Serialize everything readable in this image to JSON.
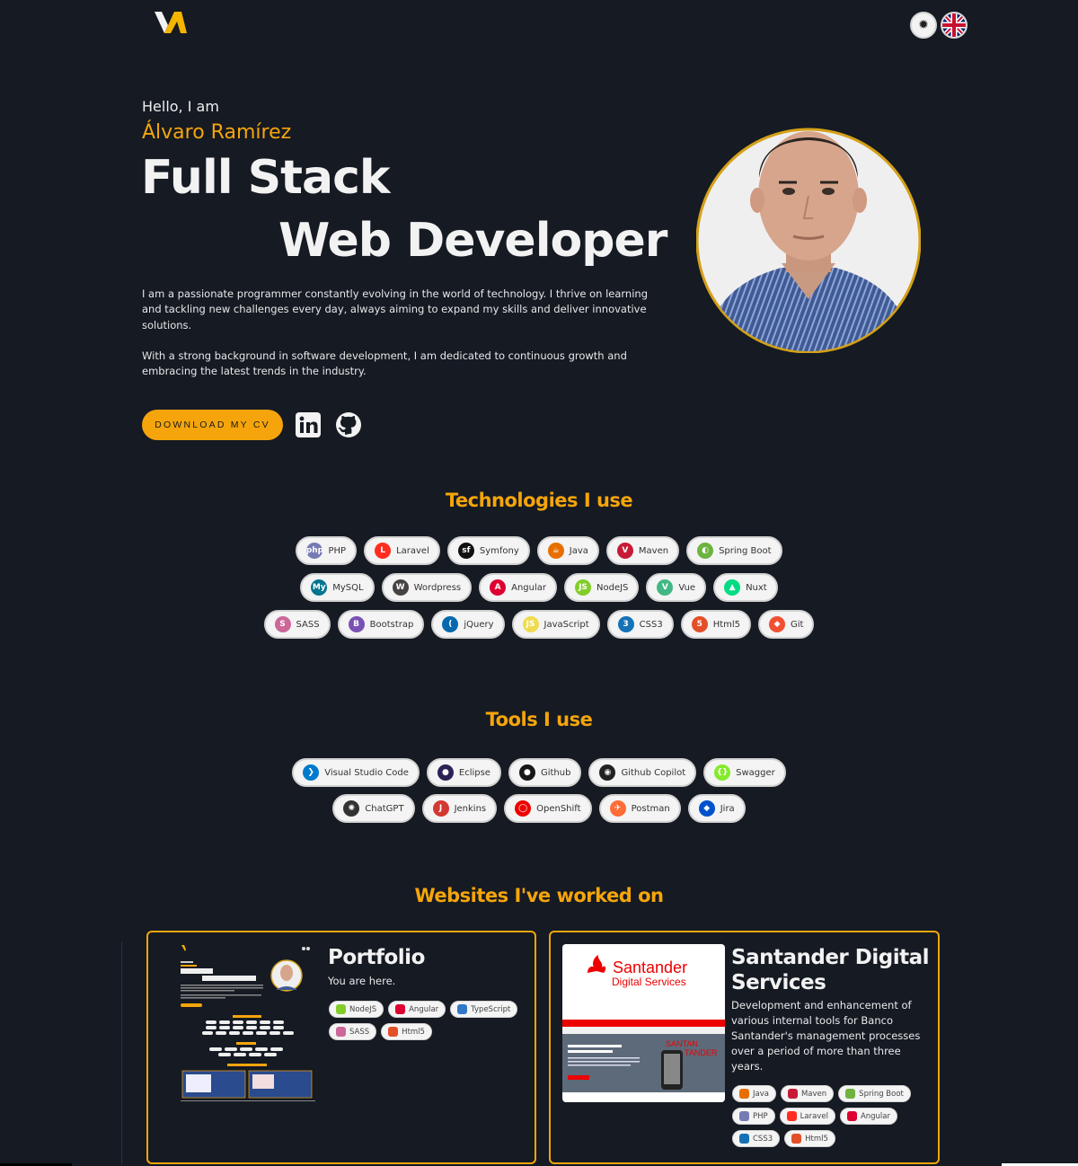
{
  "header": {
    "logo_text": "VA",
    "theme_toggle_icon": "sun-icon",
    "language_icon": "uk-flag-icon"
  },
  "hero": {
    "greeting": "Hello, I am",
    "name": "Álvaro Ramírez",
    "title_line1": "Full Stack",
    "title_line2": "Web Developer",
    "bio_p1": "I am a passionate programmer constantly evolving in the world of technology. I thrive on learning and tackling new challenges every day, always aiming to expand my skills and deliver innovative solutions.",
    "bio_p2": "With a strong background in software development, I am dedicated to continuous growth and embracing the latest trends in the industry.",
    "cv_button": "DOWNLOAD MY CV",
    "social": [
      "linkedin-icon",
      "github-icon"
    ]
  },
  "technologies": {
    "title": "Technologies I use",
    "rows": [
      [
        {
          "label": "PHP",
          "icon": "php-icon",
          "color": "#777bb3",
          "glyph": "php"
        },
        {
          "label": "Laravel",
          "icon": "laravel-icon",
          "color": "#ff2d20",
          "glyph": "L"
        },
        {
          "label": "Symfony",
          "icon": "symfony-icon",
          "color": "#111111",
          "glyph": "sf"
        },
        {
          "label": "Java",
          "icon": "java-icon",
          "color": "#e76f00",
          "glyph": "☕"
        },
        {
          "label": "Maven",
          "icon": "maven-icon",
          "color": "#c71a36",
          "glyph": "V"
        },
        {
          "label": "Spring Boot",
          "icon": "spring-boot-icon",
          "color": "#6db33f",
          "glyph": "◐"
        }
      ],
      [
        {
          "label": "MySQL",
          "icon": "mysql-icon",
          "color": "#00758f",
          "glyph": "My"
        },
        {
          "label": "Wordpress",
          "icon": "wordpress-icon",
          "color": "#464342",
          "glyph": "W"
        },
        {
          "label": "Angular",
          "icon": "angular-icon",
          "color": "#dd0031",
          "glyph": "A"
        },
        {
          "label": "NodeJS",
          "icon": "nodejs-icon",
          "color": "#83cd29",
          "glyph": "JS"
        },
        {
          "label": "Vue",
          "icon": "vue-icon",
          "color": "#41b883",
          "glyph": "V"
        },
        {
          "label": "Nuxt",
          "icon": "nuxt-icon",
          "color": "#00dc82",
          "glyph": "▲"
        }
      ],
      [
        {
          "label": "SASS",
          "icon": "sass-icon",
          "color": "#cd6799",
          "glyph": "S"
        },
        {
          "label": "Bootstrap",
          "icon": "bootstrap-icon",
          "color": "#7952b3",
          "glyph": "B"
        },
        {
          "label": "jQuery",
          "icon": "jquery-icon",
          "color": "#0769ad",
          "glyph": "("
        },
        {
          "label": "JavaScript",
          "icon": "javascript-icon",
          "color": "#f0db4f",
          "glyph": "JS"
        },
        {
          "label": "CSS3",
          "icon": "css3-icon",
          "color": "#1572b6",
          "glyph": "3"
        },
        {
          "label": "Html5",
          "icon": "html5-icon",
          "color": "#e34f26",
          "glyph": "5"
        },
        {
          "label": "Git",
          "icon": "git-icon",
          "color": "#f05032",
          "glyph": "◆"
        }
      ]
    ]
  },
  "tools": {
    "title": "Tools I use",
    "rows": [
      [
        {
          "label": "Visual Studio Code",
          "icon": "vscode-icon",
          "color": "#007acc",
          "glyph": "❯"
        },
        {
          "label": "Eclipse",
          "icon": "eclipse-icon",
          "color": "#2c2255",
          "glyph": "●"
        },
        {
          "label": "Github",
          "icon": "github-icon",
          "color": "#181717",
          "glyph": "●"
        },
        {
          "label": "Github Copilot",
          "icon": "github-copilot-icon",
          "color": "#222222",
          "glyph": "◉"
        },
        {
          "label": "Swagger",
          "icon": "swagger-icon",
          "color": "#85ea2d",
          "glyph": "{}"
        }
      ],
      [
        {
          "label": "ChatGPT",
          "icon": "chatgpt-icon",
          "color": "#333333",
          "glyph": "✺"
        },
        {
          "label": "Jenkins",
          "icon": "jenkins-icon",
          "color": "#d33833",
          "glyph": "J"
        },
        {
          "label": "OpenShift",
          "icon": "openshift-icon",
          "color": "#ee0000",
          "glyph": "◯"
        },
        {
          "label": "Postman",
          "icon": "postman-icon",
          "color": "#ff6c37",
          "glyph": "✈"
        },
        {
          "label": "Jira",
          "icon": "jira-icon",
          "color": "#0052cc",
          "glyph": "◆"
        }
      ]
    ]
  },
  "websites": {
    "title": "Websites I've worked on",
    "projects": [
      {
        "title": "Portfolio",
        "description": "You are here.",
        "tags": [
          [
            {
              "label": "NodeJS",
              "color": "#83cd29"
            },
            {
              "label": "Angular",
              "color": "#dd0031"
            },
            {
              "label": "TypeScript",
              "color": "#3178c6"
            }
          ],
          [
            {
              "label": "SASS",
              "color": "#cd6799"
            },
            {
              "label": "Html5",
              "color": "#e34f26"
            }
          ]
        ]
      },
      {
        "title": "Santander Digital Services",
        "description": "Development and enhancement of various internal tools for Banco Santander's management processes over a period of more than three years.",
        "thumb_brand": "Santander",
        "thumb_sub": "Digital Services",
        "tags": [
          [
            {
              "label": "Java",
              "color": "#e76f00"
            },
            {
              "label": "Maven",
              "color": "#c71a36"
            },
            {
              "label": "Spring Boot",
              "color": "#6db33f"
            }
          ],
          [
            {
              "label": "PHP",
              "color": "#777bb3"
            },
            {
              "label": "Laravel",
              "color": "#ff2d20"
            },
            {
              "label": "Angular",
              "color": "#dd0031"
            }
          ],
          [
            {
              "label": "CSS3",
              "color": "#1572b6"
            },
            {
              "label": "Html5",
              "color": "#e34f26"
            }
          ]
        ]
      }
    ]
  }
}
